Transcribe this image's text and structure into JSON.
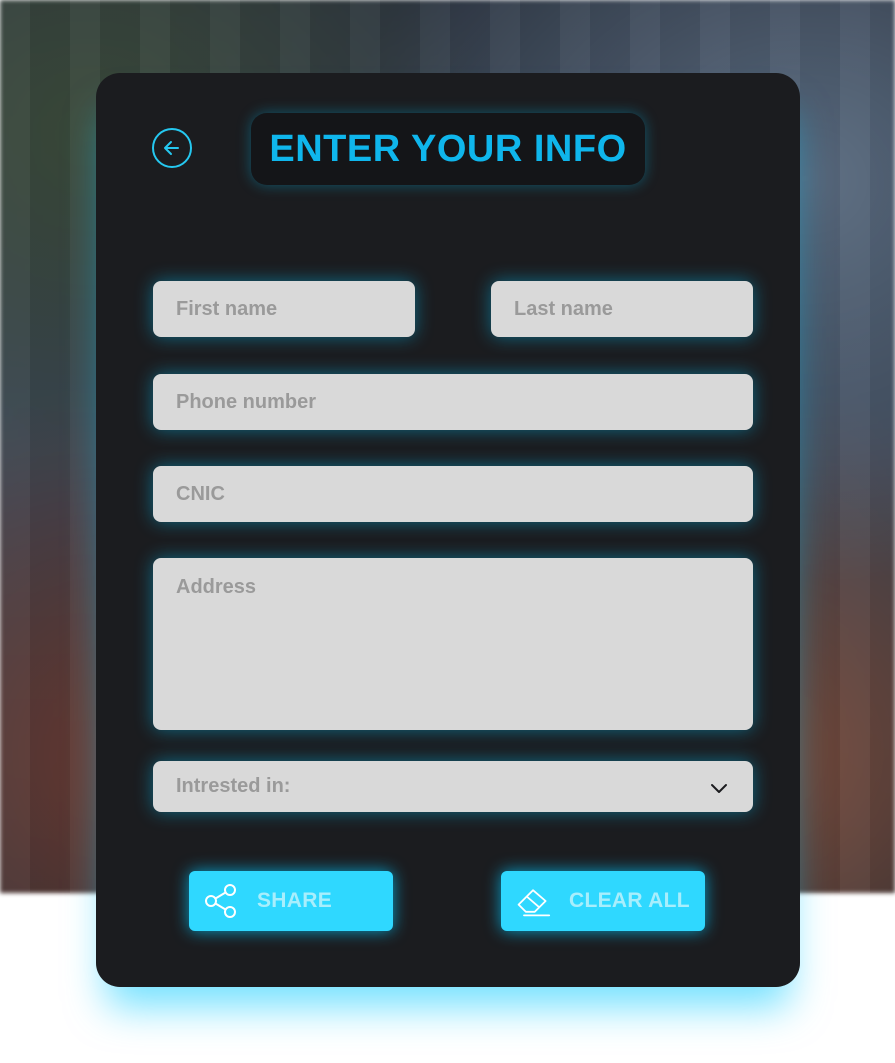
{
  "form": {
    "title": "ENTER YOUR INFO",
    "fields": {
      "first_name": {
        "placeholder": "First name"
      },
      "last_name": {
        "placeholder": "Last name"
      },
      "phone": {
        "placeholder": "Phone number"
      },
      "cnic": {
        "placeholder": "CNIC"
      },
      "address": {
        "placeholder": "Address"
      },
      "interest": {
        "placeholder": "Intrested in:"
      }
    },
    "buttons": {
      "share": "SHARE",
      "clear_all": "CLEAR ALL"
    }
  },
  "icons": {
    "back": "arrow-left-circle-icon",
    "dropdown": "chevron-down-icon",
    "share": "share-icon",
    "clear": "eraser-icon"
  },
  "colors": {
    "accent": "#2fd8ff",
    "title": "#0fb6ec",
    "card": "#1b1c1f",
    "field": "#d9d9d9",
    "placeholder": "#9a9a9a"
  }
}
